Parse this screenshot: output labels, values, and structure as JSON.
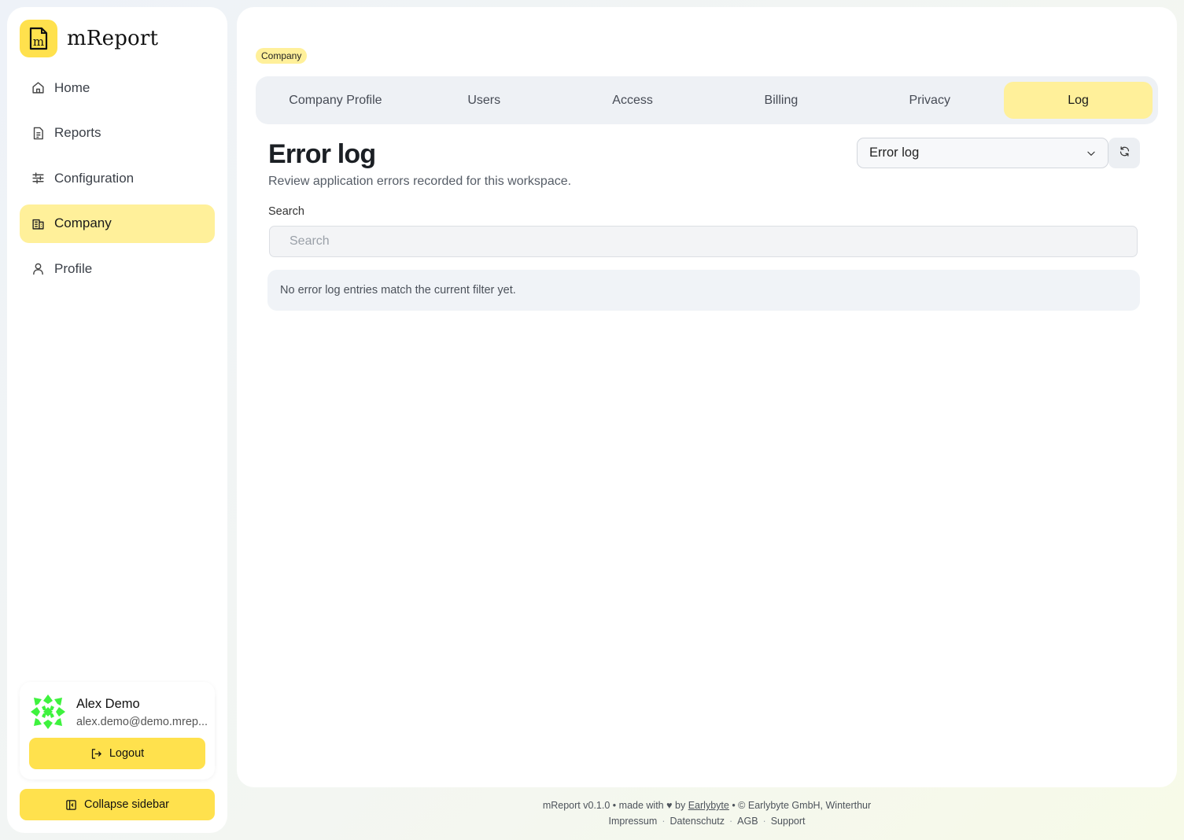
{
  "app": {
    "name": "mReport"
  },
  "sidebar": {
    "items": [
      {
        "label": "Home",
        "icon": "home-icon"
      },
      {
        "label": "Reports",
        "icon": "report-icon"
      },
      {
        "label": "Configuration",
        "icon": "sliders-icon"
      },
      {
        "label": "Company",
        "icon": "building-icon",
        "active": true
      },
      {
        "label": "Profile",
        "icon": "user-icon"
      }
    ],
    "user": {
      "name": "Alex Demo",
      "email": "alex.demo@demo.mrep..."
    },
    "logout_label": "Logout",
    "collapse_label": "Collapse sidebar"
  },
  "breadcrumb": "Company",
  "tabs": [
    {
      "label": "Company Profile"
    },
    {
      "label": "Users"
    },
    {
      "label": "Access"
    },
    {
      "label": "Billing"
    },
    {
      "label": "Privacy"
    },
    {
      "label": "Log",
      "active": true
    }
  ],
  "page": {
    "title": "Error log",
    "subtitle": "Review application errors recorded for this workspace.",
    "log_type_selected": "Error log",
    "search_label": "Search",
    "search_placeholder": "Search",
    "search_value": "",
    "empty_message": "No error log entries match the current filter yet."
  },
  "footer": {
    "version": "mReport v0.1.0",
    "made_with": "made with",
    "by": "by",
    "company_link": "Earlybyte",
    "copyright": "© Earlybyte GmbH, Winterthur",
    "links": [
      "Impressum",
      "Datenschutz",
      "AGB",
      "Support"
    ]
  },
  "colors": {
    "accent": "#ffe14d",
    "accent_soft": "#fff09a",
    "avatar_green": "#3ef23e"
  }
}
